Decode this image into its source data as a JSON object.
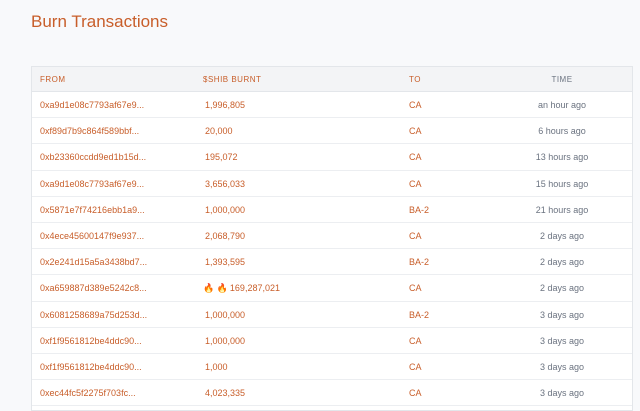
{
  "page": {
    "title": "Burn Transactions"
  },
  "table": {
    "headers": {
      "from": "FROM",
      "amount": "$SHIB BURNT",
      "to": "TO",
      "time": "TIME"
    },
    "rows": [
      {
        "from": "0xa9d1e08c7793af67e9...",
        "amount": "1,996,805",
        "to": "CA",
        "time": "an hour ago",
        "fire": ""
      },
      {
        "from": "0xf89d7b9c864f589bbf...",
        "amount": "20,000",
        "to": "CA",
        "time": "6 hours ago",
        "fire": ""
      },
      {
        "from": "0xb23360ccdd9ed1b15d...",
        "amount": "195,072",
        "to": "CA",
        "time": "13 hours ago",
        "fire": ""
      },
      {
        "from": "0xa9d1e08c7793af67e9...",
        "amount": "3,656,033",
        "to": "CA",
        "time": "15 hours ago",
        "fire": ""
      },
      {
        "from": "0x5871e7f74216ebb1a9...",
        "amount": "1,000,000",
        "to": "BA-2",
        "time": "21 hours ago",
        "fire": ""
      },
      {
        "from": "0x4ece45600147f9e937...",
        "amount": "2,068,790",
        "to": "CA",
        "time": "2 days ago",
        "fire": ""
      },
      {
        "from": "0x2e241d15a5a3438bd7...",
        "amount": "1,393,595",
        "to": "BA-2",
        "time": "2 days ago",
        "fire": ""
      },
      {
        "from": "0xa659887d389e5242c8...",
        "amount": "169,287,021",
        "to": "CA",
        "time": "2 days ago",
        "fire": "🔥 🔥"
      },
      {
        "from": "0x6081258689a75d253d...",
        "amount": "1,000,000",
        "to": "BA-2",
        "time": "3 days ago",
        "fire": ""
      },
      {
        "from": "0xf1f9561812be4ddc90...",
        "amount": "1,000,000",
        "to": "CA",
        "time": "3 days ago",
        "fire": ""
      },
      {
        "from": "0xf1f9561812be4ddc90...",
        "amount": "1,000",
        "to": "CA",
        "time": "3 days ago",
        "fire": ""
      },
      {
        "from": "0xec44fc5f2275f703fc...",
        "amount": "4,023,335",
        "to": "CA",
        "time": "3 days ago",
        "fire": ""
      }
    ]
  },
  "colors": {
    "accent": "#c85e2a",
    "muted": "#6b7380",
    "header_bg": "#f3f4f6"
  }
}
